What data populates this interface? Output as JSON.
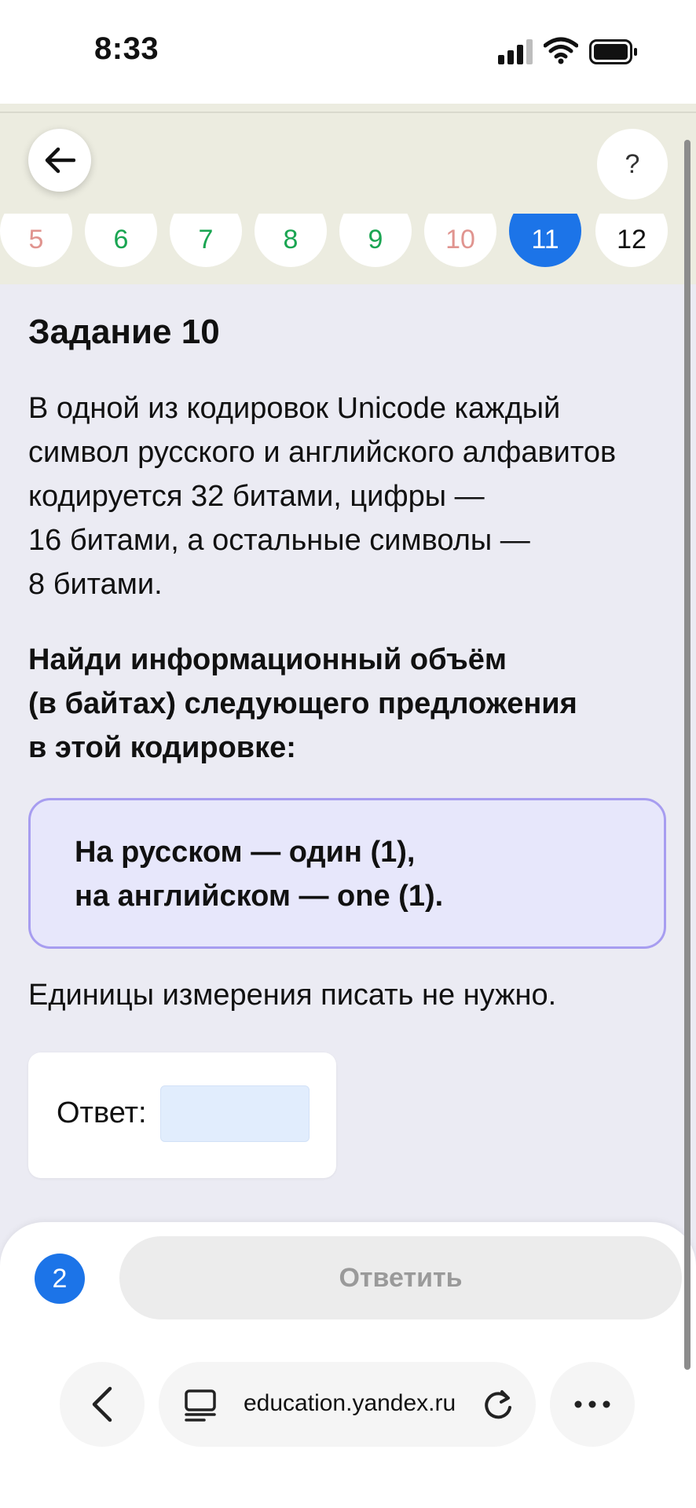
{
  "status_bar": {
    "time": "8:33"
  },
  "header": {
    "help_label": "?"
  },
  "task_nav": [
    {
      "label": "5",
      "state": "red"
    },
    {
      "label": "6",
      "state": "green"
    },
    {
      "label": "7",
      "state": "green"
    },
    {
      "label": "8",
      "state": "green"
    },
    {
      "label": "9",
      "state": "green"
    },
    {
      "label": "10",
      "state": "red"
    },
    {
      "label": "11",
      "state": "active"
    },
    {
      "label": "12",
      "state": "black"
    }
  ],
  "task": {
    "title": "Задание 10",
    "text_lines": [
      "В одной из кодировок Unicode каждый",
      "символ русского и английского алфавитов",
      "кодируется 32 битами, цифры —",
      "16 битами, а остальные символы —",
      "8 битами."
    ],
    "question_lines": [
      "Найди информационный объём",
      "(в байтах) следующего предложения",
      "в этой кодировке:"
    ],
    "sentence_lines": [
      "На русском — один (1),",
      "на английском — one (1)."
    ],
    "units_note": "Единицы измерения писать не нужно.",
    "answer_label": "Ответ:",
    "answer_value": ""
  },
  "bottom": {
    "attempts": "2",
    "submit_label": "Ответить"
  },
  "browser": {
    "url": "education.yandex.ru"
  },
  "colors": {
    "accent": "#1c74e8",
    "header_bg": "#ecece0",
    "page_bg": "#ebebf3",
    "box_bg": "#e7e7fb",
    "box_border": "#a79df0"
  }
}
